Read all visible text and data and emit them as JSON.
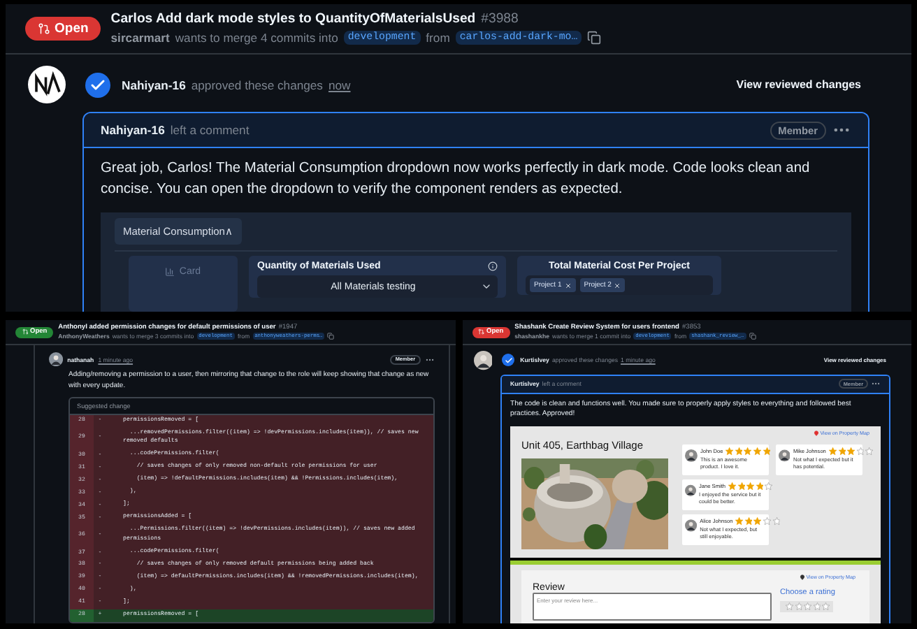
{
  "top": {
    "header": {
      "state": "Open",
      "color": "#da3633",
      "title": "Carlos Add dark mode styles to QuantityOfMaterialsUsed",
      "number": "#3988",
      "author": "sircarmart",
      "merge_text": "wants to merge 4 commits into",
      "base": "development",
      "from_text": "from",
      "head": "carlos-add-dark-mo…"
    },
    "review": {
      "reviewer": "Nahiyan-16",
      "action": "approved these changes",
      "time": "now",
      "button": "View reviewed changes"
    },
    "comment": {
      "author": "Nahiyan-16",
      "action": "left a comment",
      "badge": "Member",
      "body": "Great job, Carlos! The Material Consumption dropdown now works perfectly in dark mode. Code looks clean and concise. You can open the dropdown to verify the component renders as expected.",
      "screenshot": {
        "tab": "Material Consumption∧",
        "card_label": "Card",
        "quantity_title": "Quantity of Materials Used",
        "select_value": "All Materials testing",
        "cost_title": "Total Material Cost Per Project",
        "chips": [
          "Project 1",
          "Project 2"
        ]
      }
    }
  },
  "bottom_left": {
    "header": {
      "state": "Open",
      "color": "#238636",
      "title": "AnthonyI added permission changes for default permissions of user",
      "number": "#1947",
      "author": "AnthonyWeathers",
      "merge_text": "wants to merge 3 commits into",
      "base": "development",
      "from_text": "from",
      "head": "anthonyweathers-perms…"
    },
    "comment": {
      "author": "nathanah",
      "time": "1 minute ago",
      "badge": "Member",
      "body": "Adding/removing a permission to a user, then mirroring that change to the role will keep showing that change as new with every update.",
      "suggestion": {
        "title": "Suggested change",
        "lines": [
          {
            "number": "28",
            "sign": "-",
            "code": "permissionsRemoved = [",
            "kind": "removed"
          },
          {
            "number": "29",
            "sign": "-",
            "code": "  ...removedPermissions.filter((item) => !devPermissions.includes(item)), // saves new removed defaults",
            "kind": "removed"
          },
          {
            "number": "30",
            "sign": "-",
            "code": "  ...codePermissions.filter(",
            "kind": "removed"
          },
          {
            "number": "31",
            "sign": "-",
            "code": "    // saves changes of only removed non-default role permissions for user",
            "kind": "removed"
          },
          {
            "number": "32",
            "sign": "-",
            "code": "    (item) => !defaultPermissions.includes(item) && !Permissions.includes(item),",
            "kind": "removed"
          },
          {
            "number": "33",
            "sign": "-",
            "code": "  ),",
            "kind": "removed"
          },
          {
            "number": "34",
            "sign": "-",
            "code": "];",
            "kind": "removed"
          },
          {
            "number": "35",
            "sign": "-",
            "code": "permissionsAdded = [",
            "kind": "removed"
          },
          {
            "number": "36",
            "sign": "-",
            "code": "  ...Permissions.filter((item) => !devPermissions.includes(item)), // saves new added permissions",
            "kind": "removed"
          },
          {
            "number": "37",
            "sign": "-",
            "code": "  ...codePermissions.filter(",
            "kind": "removed"
          },
          {
            "number": "38",
            "sign": "-",
            "code": "    // saves changes of only removed default permissions being added back",
            "kind": "removed"
          },
          {
            "number": "39",
            "sign": "-",
            "code": "    (item) => defaultPermissions.includes(item) && !removedPermissions.includes(item),",
            "kind": "removed"
          },
          {
            "number": "40",
            "sign": "-",
            "code": "  ),",
            "kind": "removed"
          },
          {
            "number": "41",
            "sign": "-",
            "code": "];",
            "kind": "removed"
          },
          {
            "number": "28",
            "sign": "+",
            "code": "permissionsRemoved = [",
            "kind": "added"
          }
        ]
      }
    }
  },
  "bottom_right": {
    "header": {
      "state": "Open",
      "color": "#da3633",
      "title": "Shashank Create Review System for users frontend",
      "number": "#3853",
      "author": "shashankhe",
      "merge_text": "wants to merge 1 commit into",
      "base": "development",
      "from_text": "from",
      "head": "shashank_review_…"
    },
    "review": {
      "reviewer": "Kurtislvey",
      "action": "approved these changes",
      "time": "1 minute ago",
      "button": "View reviewed changes"
    },
    "comment": {
      "author": "Kurtislvey",
      "action": "left a comment",
      "badge": "Member",
      "body": "The code is clean and functions well. You made sure to properly apply styles to everything and followed best practices. Approved!",
      "screenshot": {
        "map_link": "View on Property Map",
        "title": "Unit 405, Earthbag Village",
        "review_columns": [
          [
            {
              "name": "John Doe",
              "stars": 5,
              "text": "This is an awesome product. I love it."
            },
            {
              "name": "Jane Smith",
              "stars": 4,
              "text": "I enjoyed the service but it could be better."
            },
            {
              "name": "Alice Johnson",
              "stars": 3,
              "text": "Not what I expected, but still enjoyable."
            }
          ],
          [
            {
              "name": "Mike Johnson",
              "stars": 3,
              "text": "Not what I expected but it has potential."
            }
          ]
        ],
        "form": {
          "map_link": "View on Property Map",
          "heading": "Review",
          "placeholder": "Enter your review here...",
          "rating_label": "Choose a rating",
          "stars": 0
        }
      }
    }
  }
}
